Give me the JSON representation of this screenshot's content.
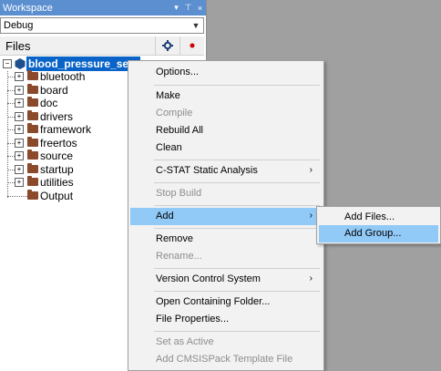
{
  "workspace": {
    "title": "Workspace",
    "title_controls": [
      "▾",
      "⊤",
      "×"
    ],
    "config_value": "Debug",
    "files_header": "Files",
    "project_name": "blood_pressure_sen",
    "folders": [
      "bluetooth",
      "board",
      "doc",
      "drivers",
      "framework",
      "freertos",
      "source",
      "startup",
      "utilities",
      "Output"
    ]
  },
  "context_menu": {
    "options": "Options...",
    "make": "Make",
    "compile": "Compile",
    "rebuild_all": "Rebuild All",
    "clean": "Clean",
    "cstat": "C-STAT Static Analysis",
    "stop_build": "Stop Build",
    "add": "Add",
    "remove": "Remove",
    "rename": "Rename...",
    "version_control": "Version Control System",
    "open_folder": "Open Containing Folder...",
    "file_properties": "File Properties...",
    "set_active": "Set as Active",
    "add_cmsis": "Add CMSISPack Template File",
    "submenu_arrow": "›"
  },
  "add_submenu": {
    "add_files": "Add Files...",
    "add_group": "Add Group..."
  },
  "colors": {
    "title_bar": "#5c8fd0",
    "selection": "#0a64c8",
    "menu_highlight": "#91c9f7",
    "disabled_text": "#8d8d8d"
  }
}
